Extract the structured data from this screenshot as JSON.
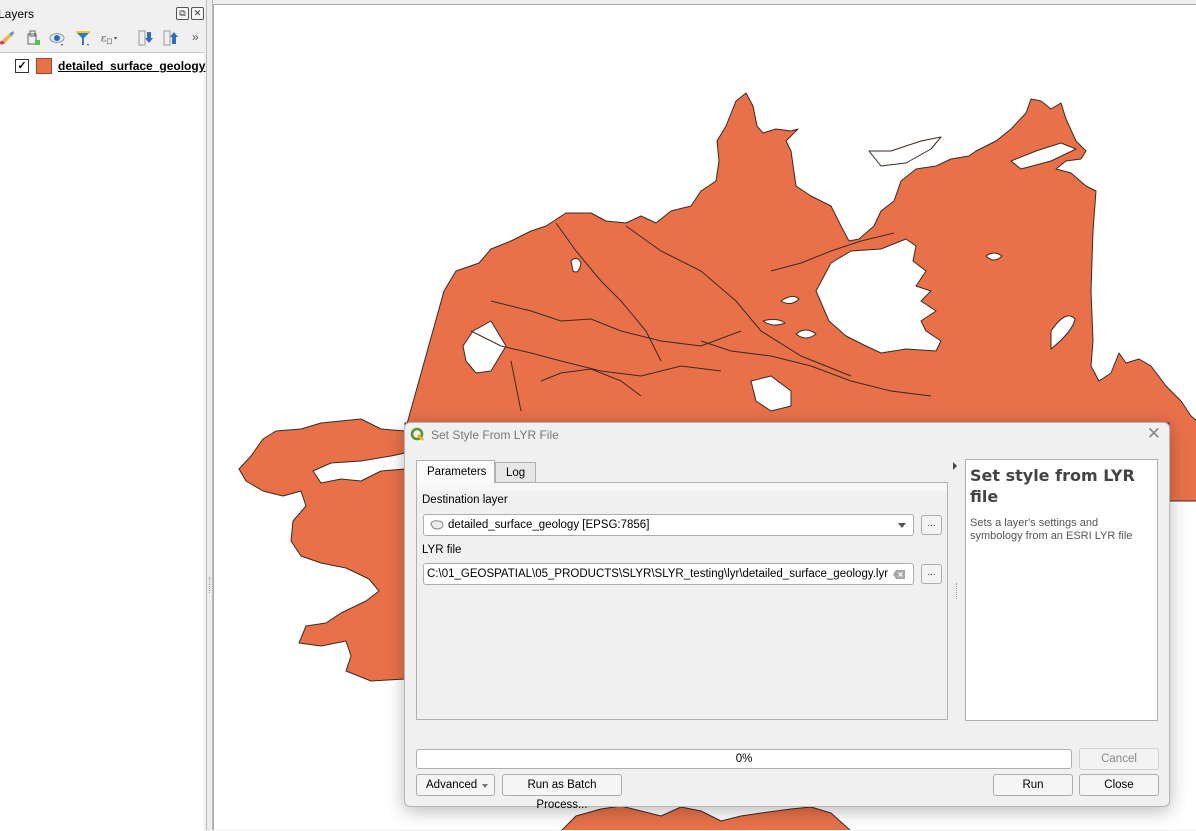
{
  "layers_panel": {
    "title": "Layers",
    "toolbar_icons": [
      "style-manager-icon",
      "add-group-icon",
      "visibility-icon",
      "filter-legend-icon",
      "expression-filter-icon",
      "expand-all-icon",
      "collapse-all-icon"
    ],
    "more": "»",
    "layers": [
      {
        "name": "detailed_surface_geology",
        "checked": true,
        "checkmark": "✓",
        "swatch_color": "#e8714a"
      }
    ]
  },
  "map": {
    "fill_color": "#e8714a",
    "stroke_color": "#3a2a22"
  },
  "dialog": {
    "title": "Set Style From LYR File",
    "close_glyph": "✕",
    "tabs": [
      {
        "label": "Parameters",
        "active": true
      },
      {
        "label": "Log",
        "active": false
      }
    ],
    "params": {
      "destination_label": "Destination layer",
      "destination_value": "detailed_surface_geology [EPSG:7856]",
      "destination_more": "...",
      "lyr_label": "LYR file",
      "lyr_value": "C:\\01_GEOSPATIAL\\05_PRODUCTS\\SLYR\\SLYR_testing\\lyr\\detailed_surface_geology.lyr",
      "lyr_browse": "..."
    },
    "help": {
      "title": "Set style from LYR file",
      "description": "Sets a layer's settings and symbology from an ESRI LYR file"
    },
    "progress": {
      "value": 0,
      "text": "0%"
    },
    "buttons": {
      "cancel": "Cancel",
      "advanced": "Advanced",
      "batch": "Run as Batch Process...",
      "run": "Run",
      "close": "Close"
    }
  }
}
